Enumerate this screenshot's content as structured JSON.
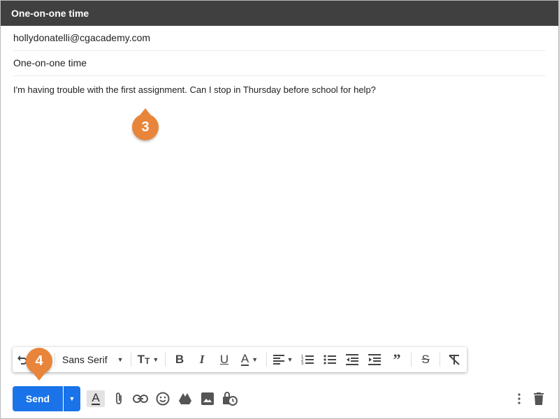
{
  "window": {
    "title": "One-on-one time"
  },
  "compose": {
    "to": "hollydonatelli@cgacademy.com",
    "subject": "One-on-one time",
    "body": "I'm having trouble with the first assignment. Can I stop in Thursday before school for help?"
  },
  "callouts": [
    "3",
    "4"
  ],
  "toolbar": {
    "font": "Sans Serif",
    "icons": [
      "undo-icon",
      "redo-icon",
      "font-family-dropdown",
      "font-size-icon",
      "bold-icon",
      "italic-icon",
      "underline-icon",
      "text-color-icon",
      "align-icon",
      "numbered-list-icon",
      "bulleted-list-icon",
      "indent-less-icon",
      "indent-more-icon",
      "quote-icon",
      "strikethrough-icon",
      "remove-formatting-icon"
    ]
  },
  "bottom": {
    "send_label": "Send",
    "icons": [
      "formatting-options-icon",
      "attach-icon",
      "link-icon",
      "emoji-icon",
      "drive-icon",
      "photo-icon",
      "confidential-icon",
      "more-options-icon",
      "discard-icon"
    ]
  },
  "colors": {
    "title_bg": "#404040",
    "send_blue": "#1a73e8",
    "callout_orange": "#e8853a"
  }
}
